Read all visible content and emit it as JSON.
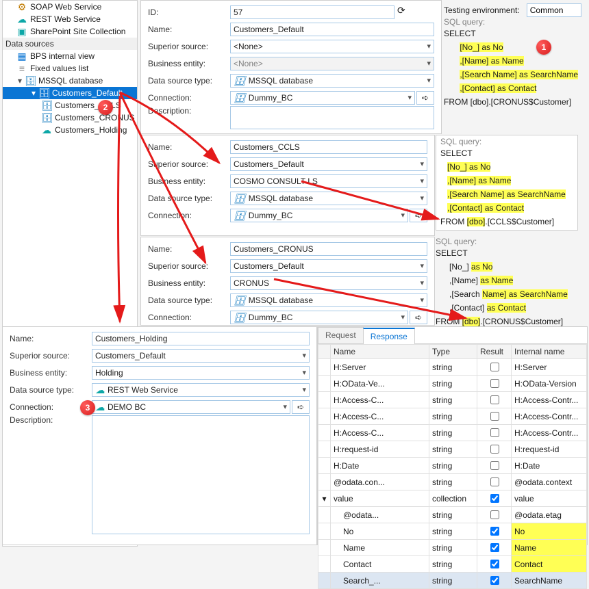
{
  "tree": {
    "top_items": [
      {
        "label": "SOAP Web Service",
        "icon": "gear-icon",
        "color": "ico-orange"
      },
      {
        "label": "REST Web Service",
        "icon": "rest-icon",
        "color": "ico-cyan"
      },
      {
        "label": "SharePoint Site Collection",
        "icon": "sharepoint-icon",
        "color": "ico-cyan"
      }
    ],
    "section": "Data sources",
    "items": [
      {
        "label": "BPS internal view",
        "icon": "table-icon",
        "color": "ico-blue"
      },
      {
        "label": "Fixed values list",
        "icon": "list-icon",
        "color": "ico-gray"
      }
    ],
    "db_label": "MSSQL database",
    "selected": "Customers_Default",
    "children": [
      {
        "label": "Customers_CCLS",
        "icon": "db-icon"
      },
      {
        "label": "Customers_CRONUS",
        "icon": "db-icon"
      },
      {
        "label": "Customers_Holding",
        "icon": "rest-icon"
      }
    ]
  },
  "labels": {
    "id": "ID:",
    "name": "Name:",
    "superior": "Superior source:",
    "entity": "Business entity:",
    "type": "Data source type:",
    "conn": "Connection:",
    "desc": "Description:",
    "testenv": "Testing environment:",
    "sql": "SQL query:"
  },
  "p1": {
    "id": "57",
    "name": "Customers_Default",
    "superior": "<None>",
    "entity": "<None>",
    "type": "MSSQL database",
    "conn": "Dummy_BC",
    "testenv": "Common",
    "sql": "SELECT\n       [No_] as No\n       ,[Name] as Name\n       ,[Search Name] as SearchName\n       ,[Contact] as Contact\nFROM [dbo].[CRONUS$Customer]"
  },
  "p2": {
    "name": "Customers_CCLS",
    "superior": "Customers_Default",
    "entity": "COSMO CONSULT LS",
    "type": "MSSQL database",
    "conn": "Dummy_BC",
    "sql": "SELECT\n       [No_] as No\n       ,[Name] as Name\n       ,[Search Name] as SearchName\n       ,[Contact] as Contact\nFROM [dbo].[CCLS$Customer]"
  },
  "p3": {
    "name": "Customers_CRONUS",
    "superior": "Customers_Default",
    "entity": "CRONUS",
    "type": "MSSQL database",
    "conn": "Dummy_BC",
    "sql": "SELECT\n       [No_] as No\n       ,[Name] as Name\n       ,[Search Name] as SearchName\n       ,[Contact] as Contact\nFROM [dbo].[CRONUS$Customer]"
  },
  "p4": {
    "name": "Customers_Holding",
    "superior": "Customers_Default",
    "entity": "Holding",
    "type": "REST Web Service",
    "conn": "DEMO BC"
  },
  "tabs": {
    "req": "Request",
    "res": "Response"
  },
  "grid": {
    "cols": [
      "Name",
      "Type",
      "Result",
      "Internal name"
    ],
    "rows": [
      {
        "n": "H:Server",
        "t": "string",
        "r": false,
        "i": "H:Server",
        "d": 1
      },
      {
        "n": "H:OData-Ve...",
        "t": "string",
        "r": false,
        "i": "H:OData-Version",
        "d": 1
      },
      {
        "n": "H:Access-C...",
        "t": "string",
        "r": false,
        "i": "H:Access-Contr...",
        "d": 1
      },
      {
        "n": "H:Access-C...",
        "t": "string",
        "r": false,
        "i": "H:Access-Contr...",
        "d": 1
      },
      {
        "n": "H:Access-C...",
        "t": "string",
        "r": false,
        "i": "H:Access-Contr...",
        "d": 1
      },
      {
        "n": "H:request-id",
        "t": "string",
        "r": false,
        "i": "H:request-id",
        "d": 1
      },
      {
        "n": "H:Date",
        "t": "string",
        "r": false,
        "i": "H:Date",
        "d": 1
      },
      {
        "n": "@odata.con...",
        "t": "string",
        "r": false,
        "i": "@odata.context",
        "d": 1
      },
      {
        "n": "value",
        "t": "collection",
        "r": true,
        "i": "value",
        "d": 1,
        "expand": true
      },
      {
        "n": "@odata...",
        "t": "string",
        "r": false,
        "i": "@odata.etag",
        "d": 2
      },
      {
        "n": "No",
        "t": "string",
        "r": true,
        "i": "No",
        "d": 2,
        "hl": true
      },
      {
        "n": "Name",
        "t": "string",
        "r": true,
        "i": "Name",
        "d": 2,
        "hl": true
      },
      {
        "n": "Contact",
        "t": "string",
        "r": true,
        "i": "Contact",
        "d": 2,
        "hl": true
      },
      {
        "n": "Search_...",
        "t": "string",
        "r": true,
        "i": "SearchName",
        "d": 2,
        "hl": true,
        "sel": true
      }
    ]
  },
  "badges": {
    "b1": "1",
    "b2": "2",
    "b3": "3"
  }
}
